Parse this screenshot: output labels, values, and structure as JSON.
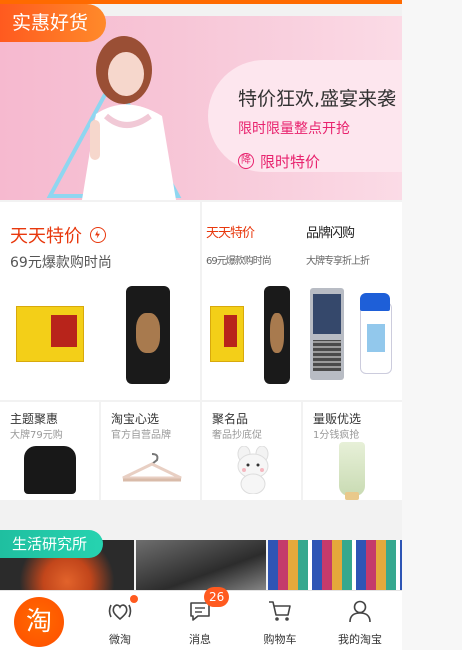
{
  "banner": {
    "tag": "实惠好货",
    "title": "特价狂欢,盛宴来袭",
    "subtitle": "限时限量整点开抢",
    "button_icon": "降",
    "button_label": "限时特价"
  },
  "deals": {
    "left": {
      "title": "天天特价",
      "subtitle": "69元爆款购时尚"
    },
    "right": {
      "left_title": "天天特价",
      "left_subtitle": "69元爆款购时尚",
      "right_title": "品牌闪购",
      "right_subtitle": "大牌专享折上折"
    }
  },
  "categories": [
    {
      "title": "主题聚惠",
      "subtitle": "大牌79元购",
      "icon": "hoodie"
    },
    {
      "title": "淘宝心选",
      "subtitle": "官方自营品牌",
      "icon": "hanger"
    },
    {
      "title": "聚名品",
      "subtitle": "奢品抄底促",
      "icon": "bear-plush"
    },
    {
      "title": "量贩优选",
      "subtitle": "1分钱疯抢",
      "icon": "skincare-tube"
    }
  ],
  "life": {
    "tag": "生活研究所"
  },
  "tabbar": {
    "home_glyph": "淘",
    "items": [
      {
        "label": "微淘",
        "icon": "weitao-icon"
      },
      {
        "label": "消息",
        "icon": "message-icon",
        "badge": "26"
      },
      {
        "label": "购物车",
        "icon": "cart-icon"
      },
      {
        "label": "我的淘宝",
        "icon": "user-icon"
      }
    ]
  },
  "colors": {
    "accent": "#ff6a00",
    "pink": "#e8236e",
    "deal_red": "#e8380d",
    "teal": "#1fbfa0"
  }
}
